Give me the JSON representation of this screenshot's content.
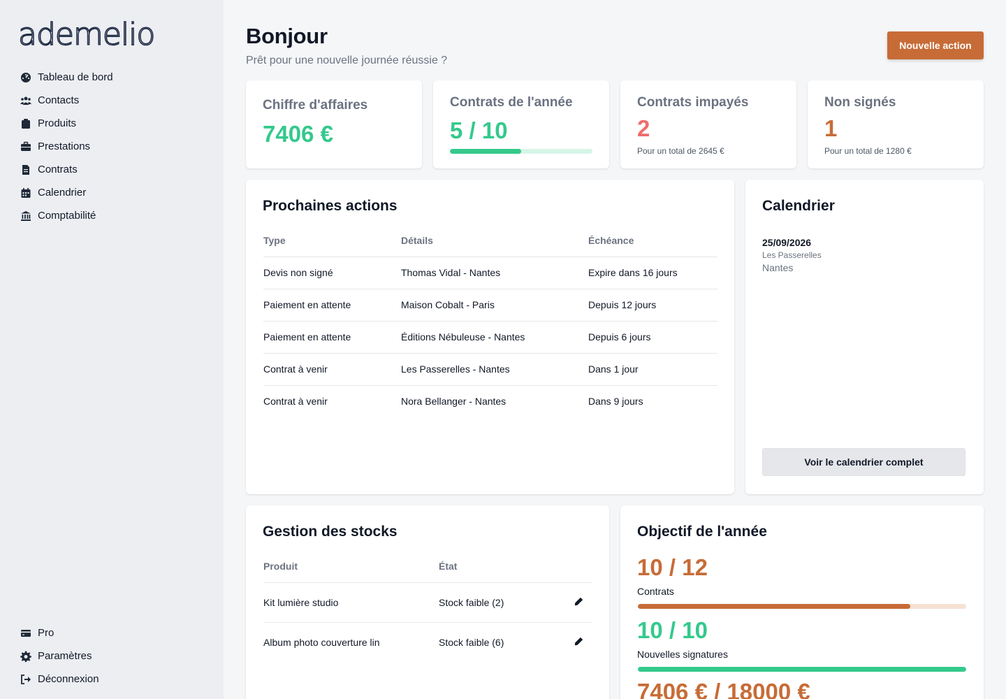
{
  "brand": {
    "logo_text": "ademelio"
  },
  "sidebar": {
    "items": [
      {
        "label": "Tableau de bord",
        "icon": "dashboard-icon"
      },
      {
        "label": "Contacts",
        "icon": "users-icon"
      },
      {
        "label": "Produits",
        "icon": "box-icon"
      },
      {
        "label": "Prestations",
        "icon": "briefcase-icon"
      },
      {
        "label": "Contrats",
        "icon": "contract-icon"
      },
      {
        "label": "Calendrier",
        "icon": "calendar-icon"
      },
      {
        "label": "Comptabilité",
        "icon": "bank-icon"
      }
    ],
    "bottom_items": [
      {
        "label": "Pro",
        "icon": "credit-card-icon"
      },
      {
        "label": "Paramètres",
        "icon": "gear-icon"
      },
      {
        "label": "Déconnexion",
        "icon": "logout-icon"
      }
    ]
  },
  "header": {
    "title": "Bonjour",
    "subtitle": "Prêt pour une nouvelle journée réussie ?",
    "primary_button": "Nouvelle action"
  },
  "stats": {
    "revenue": {
      "title": "Chiffre d'affaires",
      "value": "7406 €"
    },
    "contracts_year": {
      "title": "Contrats de l'année",
      "value": "5 / 10",
      "progress": 0.5
    },
    "unpaid": {
      "title": "Contrats impayés",
      "value": "2",
      "sub": "Pour un total de 2645 €"
    },
    "unsigned": {
      "title": "Non signés",
      "value": "1",
      "sub": "Pour un total de 1280 €"
    }
  },
  "actions": {
    "title": "Prochaines actions",
    "columns": [
      "Type",
      "Détails",
      "Échéance"
    ],
    "rows": [
      [
        "Devis non signé",
        "Thomas Vidal - Nantes",
        "Expire dans 16 jours"
      ],
      [
        "Paiement en attente",
        "Maison Cobalt - Paris",
        "Depuis 12 jours"
      ],
      [
        "Paiement en attente",
        "Éditions Nébuleuse - Nantes",
        "Depuis 6 jours"
      ],
      [
        "Contrat à venir",
        "Les Passerelles - Nantes",
        "Dans 1 jour"
      ],
      [
        "Contrat à venir",
        "Nora Bellanger - Nantes",
        "Dans 9 jours"
      ]
    ]
  },
  "calendar": {
    "title": "Calendrier",
    "event": {
      "date": "25/09/2026",
      "name": "Les Passerelles",
      "city": "Nantes"
    },
    "button": "Voir le calendrier complet"
  },
  "stock": {
    "title": "Gestion des stocks",
    "columns": [
      "Produit",
      "État"
    ],
    "rows": [
      [
        "Kit lumière studio",
        "Stock faible (2)"
      ],
      [
        "Album photo couverture lin",
        "Stock faible (6)"
      ]
    ]
  },
  "goals": {
    "title": "Objectif de l'année",
    "contracts": {
      "value": "10 / 12",
      "label": "Contrats",
      "progress": 0.83
    },
    "signatures": {
      "value": "10 / 10",
      "label": "Nouvelles signatures",
      "progress": 1.0
    },
    "revenue": {
      "value": "7406 € / 18000 €"
    }
  },
  "colors": {
    "accent": "#c76c37",
    "green": "#34c98c",
    "red": "#ef6c6c",
    "sidebar_bg": "#eceef2"
  }
}
